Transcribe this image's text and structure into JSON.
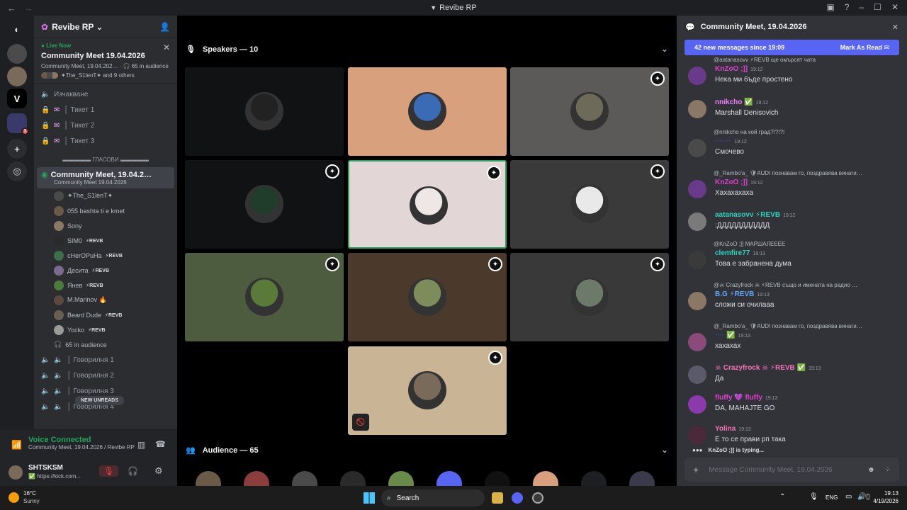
{
  "window": {
    "title": "Revibe RP",
    "nav_back": "←",
    "nav_fwd": "→"
  },
  "guilds": {
    "home_icon": "discord-logo-icon",
    "badge_count": "3",
    "add_icon": "plus-icon",
    "discover_icon": "compass-icon",
    "v_logo": "V"
  },
  "server": {
    "name": "Revibe RP",
    "live": {
      "label": "Live Now",
      "title": "Community Meet 19.04.2026",
      "meta": "Community Meet, 19.04.202…  · 🎧 65 in audience",
      "others": "✦The_S1lenT✦ and 9 others"
    },
    "channels_top": [
      {
        "label": "Изчакване",
        "icon": "speaker-icon"
      },
      {
        "label": "│ Тикет 1",
        "icon": "lock-icon"
      },
      {
        "label": "│ Тикет 2",
        "icon": "lock-icon"
      },
      {
        "label": "│ Тикет 3",
        "icon": "lock-icon"
      }
    ],
    "category": "▬▬▬▬▬ ГЛАСОВИ ▬▬▬▬▬",
    "active_channel": {
      "name": "Community Meet, 19.04.2…",
      "sub": "Community Meet 19.04.2026"
    },
    "users": [
      {
        "name": "✦The_S1lenT✦",
        "tag": "",
        "color": "#4a4a4a"
      },
      {
        "name": "055 bashta ti e kmet",
        "tag": "",
        "color": "#6b5a48"
      },
      {
        "name": "Sony",
        "tag": "",
        "color": "#8a7766"
      },
      {
        "name": "SIM0",
        "tag": "⚡REVB",
        "color": "#2a2a2a"
      },
      {
        "name": "cHerOPuHa",
        "tag": "⚡REVB",
        "color": "#3e6e4a"
      },
      {
        "name": "Десита",
        "tag": "⚡REVB",
        "color": "#7a6b8e"
      },
      {
        "name": "Янев",
        "tag": "⚡REVB",
        "color": "#4d7a3e"
      },
      {
        "name": "M.Marinov 🔥",
        "tag": "",
        "color": "#5a4a3e"
      },
      {
        "name": "Beard Dude",
        "tag": "⚡REVB",
        "color": "#6a5e52"
      },
      {
        "name": "Yocko",
        "tag": "⚡REVB",
        "color": "#9a9a9a"
      }
    ],
    "audience_count": "65 in audience",
    "channels_bottom": [
      {
        "label": "│ Говорилня 1"
      },
      {
        "label": "│ Говорилня 2"
      },
      {
        "label": "│ Говорилня 3"
      },
      {
        "label": "│ Говорилня 4"
      }
    ],
    "new_unreads": "NEW UNREADS"
  },
  "voice": {
    "status": "Voice Connected",
    "where": "Community Meet, 19.04.2026 / Revibe RP"
  },
  "me": {
    "name": "SHTSKSM",
    "status": "✅ https://kick.com..."
  },
  "stage": {
    "speakers_label": "Speakers — 10",
    "audience_label": "Audience — 65",
    "tiles": [
      {
        "bg": "#111214",
        "ring": "#222",
        "mod": false
      },
      {
        "bg": "#d9a07e",
        "ring": "#3b6bb5",
        "mod": false
      },
      {
        "bg": "#5b5a59",
        "ring": "#6d6a5a",
        "mod": true
      },
      {
        "bg": "#111214",
        "ring": "#1f3d2a",
        "mod": true
      },
      {
        "bg": "#e2d6d7",
        "ring": "#efe6e6",
        "mod": true,
        "active": true
      },
      {
        "bg": "#3a3a3a",
        "ring": "#e9e9e9",
        "mod": true
      },
      {
        "bg": "#4d5c3e",
        "ring": "#5a7a3a",
        "mod": true
      },
      {
        "bg": "#4b3a2c",
        "ring": "#7e8b5a",
        "mod": true
      },
      {
        "bg": "#393939",
        "ring": "#6d7a6a",
        "mod": true
      },
      {
        "bg": "#c9b596",
        "ring": "#7a6a5a",
        "mod": true,
        "muted": true
      }
    ],
    "audience_colors": [
      "#6b5a48",
      "#8a3e3e",
      "#4a4a4a",
      "#2a2a2a",
      "#6a8a4a",
      "#5865f2",
      "#111",
      "#d9a07e",
      "#1e1f22",
      "#3a3a4a"
    ]
  },
  "chat": {
    "title": "Community Meet, 19.04.2026",
    "new_messages": "42 new messages since 19:09",
    "mark_read": "Mark As Read",
    "messages": [
      {
        "reply": "@aatanasovv ⚡REVB  ще омърсят чата",
        "author": "KnZoO ;]]",
        "color": "#e040d0",
        "time": "19:12",
        "text": "Нека ми бъде простено",
        "av": "#6a3a8a"
      },
      {
        "reply": "",
        "author": "nnikcho ✅",
        "color": "#f47fff",
        "time": "19:12",
        "text": "Marshall Denisovich",
        "av": "#8a7766"
      },
      {
        "reply": "@nnikcho  на кой град?!?!?!",
        "author": "·······",
        "color": "#3b45a8",
        "time": "19:12",
        "text": "Смочево",
        "av": "#4a4a4a"
      },
      {
        "reply": "@_Rambo'a_  🛡AUDI  познавам го, поздравява винаги…",
        "author": "KnZoO ;]]",
        "color": "#e040d0",
        "time": "19:12",
        "text": "Хахахахаха",
        "av": "#6a3a8a"
      },
      {
        "reply": "",
        "author": "aatanasovv ⚡REVB",
        "color": "#2dd4bf",
        "time": "19:12",
        "text": ":ДДДДДДДДДДД",
        "av": "#7a7a7a"
      },
      {
        "reply": "@KnZoO ;]]  МАРШАЛЕЕЕЕ",
        "author": "clemfire77",
        "color": "#2dd4bf",
        "time": "19:13",
        "text": "Това е забранена дума",
        "av": "#3a3a3a"
      },
      {
        "reply": "@☠ Crazyfrock ☠  ⚡REVB  също и имената на радио …",
        "author": "B.G ⚡REVB",
        "color": "#60a5fa",
        "time": "19:13",
        "text": "сложи си очилааа",
        "av": "#8a7766"
      },
      {
        "reply": "@_Rambo'a_  🛡AUDI  познавам го, поздравява винаги…",
        "author": "···· ✅",
        "color": "#3b45a8",
        "time": "19:13",
        "text": "хахахах",
        "av": "#8a4a7a"
      },
      {
        "reply": "",
        "author": "☠ Crazyfrock ☠ ⚡REVB ✅",
        "color": "#f472b6",
        "time": "19:13",
        "text": "Да",
        "av": "#5a5a6a"
      },
      {
        "reply": "",
        "author": "fluffy 💜 fluffy",
        "color": "#e040d0",
        "time": "19:13",
        "text": "DA, MAHAJTE GO",
        "av": "#8a3aaa"
      },
      {
        "reply": "",
        "author": "Yolina",
        "color": "#f472b6",
        "time": "19:13",
        "text": "Е то се прави рп така",
        "av": "#4a2a3a"
      }
    ],
    "typing": "KnZoO ;]] is typing...",
    "placeholder": "Message Community Meet, 19.04.2026"
  },
  "taskbar": {
    "weather_temp": "16°C",
    "weather_desc": "Sunny",
    "search": "Search",
    "lang": "ENG",
    "time": "19:13",
    "date": "4/19/2026"
  }
}
